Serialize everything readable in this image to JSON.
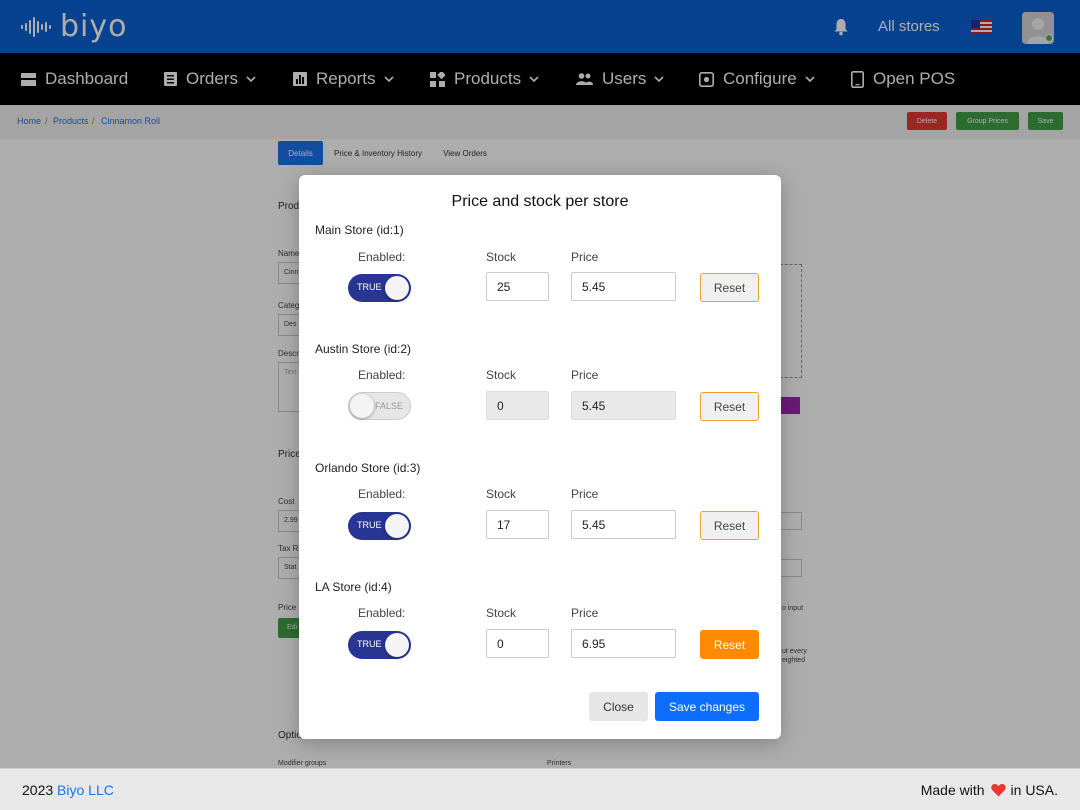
{
  "header": {
    "logo_text": "biyo",
    "store_selector": "All stores",
    "icons": [
      "bell-icon",
      "us-flag-icon",
      "user-avatar-icon"
    ]
  },
  "nav": {
    "dashboard": "Dashboard",
    "orders": "Orders",
    "reports": "Reports",
    "products": "Products",
    "users": "Users",
    "configure": "Configure",
    "open_pos": "Open POS"
  },
  "breadcrumb": {
    "home": "Home",
    "products": "Products",
    "current": "Cinnamon Roll",
    "separator": "/"
  },
  "toolbar": {
    "delete_label": "Delete",
    "group_prices_label": "Group Prices",
    "save_label": "Save"
  },
  "tabs": {
    "details": "Details",
    "price_history": "Price & Inventory History",
    "view_orders": "View Orders"
  },
  "background_form": {
    "product_heading": "Prod",
    "name_label": "Name",
    "name_value": "Cinn",
    "category_label": "Categ",
    "category_value": "Des",
    "description_label": "Descr",
    "description_placeholder": "Text",
    "price_heading": "Price",
    "cost_label": "Cost",
    "cost_value": "2.99",
    "tax_label": "Tax Ra",
    "tax_value": "Stat",
    "price_label": "Price",
    "edit_button": "Edi",
    "right_hint_1": "o input",
    "right_hint_2": "ut every",
    "right_hint_3": "eighted",
    "options_heading": "Optio",
    "modifier_groups_label": "Modifier groups",
    "printers_label": "Printers"
  },
  "modal": {
    "title": "Price and stock per store",
    "enabled_label": "Enabled:",
    "stock_label": "Stock",
    "price_label": "Price",
    "reset_label": "Reset",
    "close_label": "Close",
    "save_label": "Save changes",
    "stores": [
      {
        "name": "Main Store (id:1)",
        "enabled": "TRUE",
        "stock": "25",
        "price": "5.45"
      },
      {
        "name": "Austin Store (id:2)",
        "enabled": "FALSE",
        "stock": "0",
        "price": "5.45"
      },
      {
        "name": "Orlando Store (id:3)",
        "enabled": "TRUE",
        "stock": "17",
        "price": "5.45"
      },
      {
        "name": "LA Store (id:4)",
        "enabled": "TRUE",
        "stock": "0",
        "price": "6.95"
      }
    ]
  },
  "footer": {
    "year": "2023",
    "company": "Biyo LLC",
    "made_with": "Made with",
    "in_usa": "in USA."
  },
  "colors": {
    "brand_blue": "#0b62d6",
    "toggle_on": "#283593",
    "reset_active": "#ff8a00",
    "primary": "#0d6efd"
  }
}
